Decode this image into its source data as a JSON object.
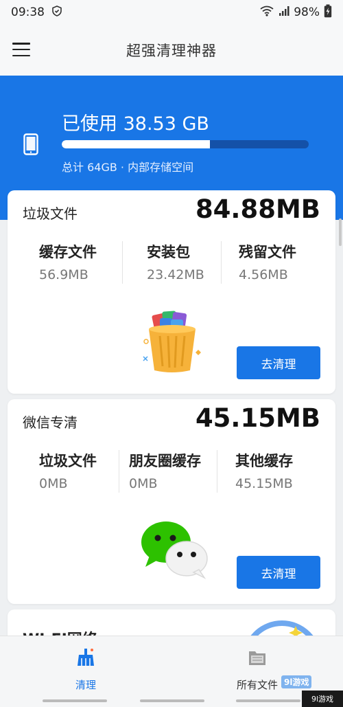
{
  "status": {
    "time": "09:38",
    "battery": "98%"
  },
  "header": {
    "title": "超强清理神器"
  },
  "storage": {
    "used_label": "已使用 38.53 GB",
    "total_label": "总计 64GB · 内部存储空间",
    "used_fraction": 0.6
  },
  "junk": {
    "title": "垃圾文件",
    "total": "84.88MB",
    "items": [
      {
        "label": "缓存文件",
        "value": "56.9MB"
      },
      {
        "label": "安装包",
        "value": "23.42MB"
      },
      {
        "label": "残留文件",
        "value": "4.56MB"
      }
    ],
    "button": "去清理"
  },
  "wechat": {
    "title": "微信专清",
    "total": "45.15MB",
    "items": [
      {
        "label": "垃圾文件",
        "value": "0MB"
      },
      {
        "label": "朋友圈缓存",
        "value": "0MB"
      },
      {
        "label": "其他缓存",
        "value": "45.15MB"
      }
    ],
    "button": "去清理"
  },
  "wifi": {
    "title": "WI-FI网络"
  },
  "nav": {
    "items": [
      {
        "label": "清理",
        "active": true
      },
      {
        "label": "所有文件",
        "active": false
      }
    ]
  },
  "watermark": {
    "badge": "9l游戏",
    "corner": "9l游戏"
  },
  "colors": {
    "accent": "#1976e6",
    "bar_track": "#1451a8",
    "wechat_green": "#2dc100"
  }
}
